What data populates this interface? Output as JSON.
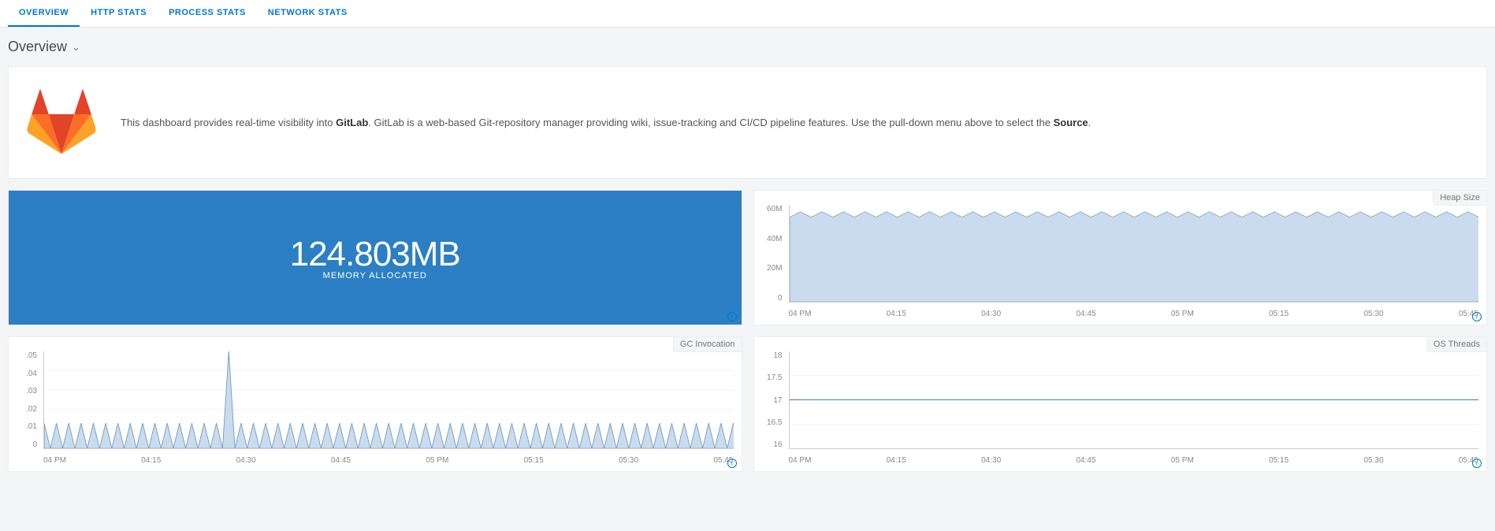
{
  "tabs": [
    "OVERVIEW",
    "HTTP STATS",
    "PROCESS STATS",
    "NETWORK STATS"
  ],
  "active_tab": 0,
  "page_title": "Overview",
  "info": {
    "pre": "This dashboard provides real-time visibility into ",
    "bold1": "GitLab",
    "mid": ". GitLab is a web-based Git-repository manager providing wiki, issue-tracking and CI/CD pipeline features. Use the pull-down menu above to select the ",
    "bold2": "Source",
    "post": "."
  },
  "big_metric": {
    "value": "124.803MB",
    "label": "MEMORY ALLOCATED"
  },
  "panels": {
    "heap": {
      "title": "Heap Size"
    },
    "gc": {
      "title": "GC Invocation"
    },
    "os": {
      "title": "OS Threads"
    }
  },
  "x_ticks": [
    "04 PM",
    "04:15",
    "04:30",
    "04:45",
    "05 PM",
    "05:15",
    "05:30",
    "05:45"
  ],
  "chart_data": [
    {
      "type": "area",
      "id": "heap_size",
      "title": "Heap Size",
      "x_categories": [
        "04 PM",
        "04:15",
        "04:30",
        "04:45",
        "05 PM",
        "05:15",
        "05:30",
        "05:45"
      ],
      "y_ticks": [
        "60M",
        "40M",
        "20M",
        "0"
      ],
      "ylim": [
        0,
        70000000
      ],
      "series": [
        {
          "name": "heap",
          "approx_constant": 62000000,
          "ripple_amplitude": 3000000,
          "ripple_count": 64
        }
      ]
    },
    {
      "type": "area",
      "id": "gc_invocation",
      "title": "GC Invocation",
      "x_categories": [
        "04 PM",
        "04:15",
        "04:30",
        "04:45",
        "05 PM",
        "05:15",
        "05:30",
        "05:45"
      ],
      "y_ticks": [
        ".05",
        ".04",
        ".03",
        ".02",
        ".01",
        "0"
      ],
      "ylim": [
        0,
        0.05
      ],
      "series": [
        {
          "name": "gc",
          "baseline_peak": 0.013,
          "spike_value": 0.05,
          "spike_at_category": "04:30",
          "tooth_count": 56
        }
      ]
    },
    {
      "type": "line",
      "id": "os_threads",
      "title": "OS Threads",
      "x_categories": [
        "04 PM",
        "04:15",
        "04:30",
        "04:45",
        "05 PM",
        "05:15",
        "05:30",
        "05:45"
      ],
      "y_ticks": [
        "18",
        "17.5",
        "17",
        "16.5",
        "16"
      ],
      "ylim": [
        16,
        18
      ],
      "series": [
        {
          "name": "threads",
          "constant_value": 17
        }
      ]
    }
  ]
}
